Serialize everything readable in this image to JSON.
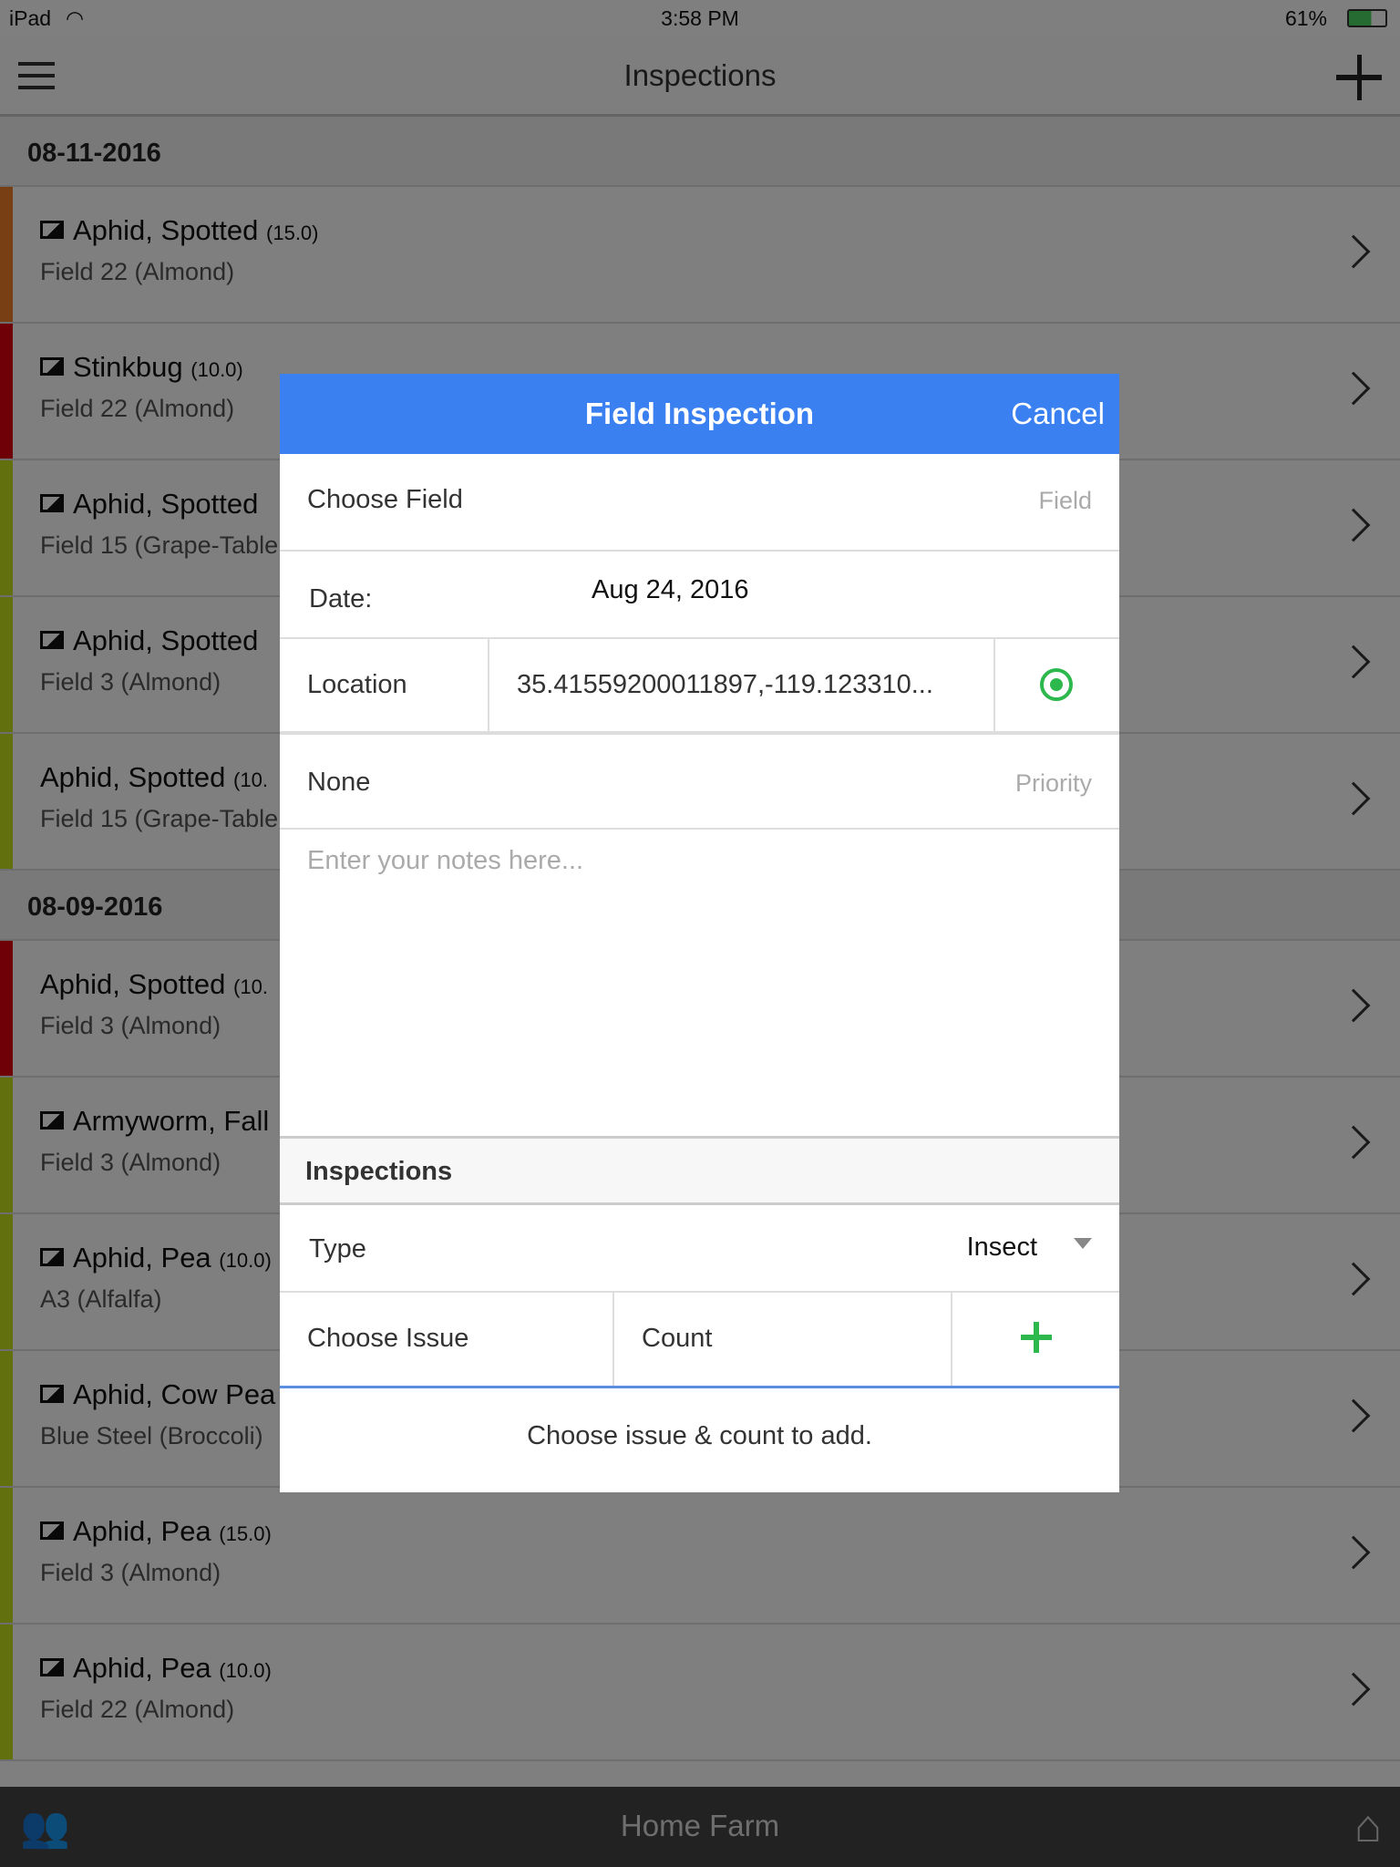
{
  "status_bar": {
    "device": "iPad",
    "time": "3:58 PM",
    "battery": "61%"
  },
  "nav": {
    "title": "Inspections"
  },
  "groups": [
    {
      "date": "08-11-2016",
      "rows": [
        {
          "title": "Aphid, Spotted",
          "count": "(15.0)",
          "subtitle": "Field 22 (Almond)",
          "photo": true,
          "color": "#f07f2a"
        },
        {
          "title": "Stinkbug",
          "count": "(10.0)",
          "subtitle": "Field 22 (Almond)",
          "photo": true,
          "color": "#e00010"
        },
        {
          "title": "Aphid, Spotted",
          "count": "",
          "subtitle": "Field 15 (Grape-Table",
          "photo": true,
          "color": "#c4e21c"
        },
        {
          "title": "Aphid, Spotted",
          "count": "",
          "subtitle": "Field 3 (Almond)",
          "photo": true,
          "color": "#c4e21c"
        },
        {
          "title": "Aphid, Spotted",
          "count": "(10.",
          "subtitle": "Field 15 (Grape-Table",
          "photo": false,
          "color": "#c4e21c"
        }
      ]
    },
    {
      "date": "08-09-2016",
      "rows": [
        {
          "title": "Aphid, Spotted",
          "count": "(10.",
          "subtitle": "Field 3 (Almond)",
          "photo": false,
          "color": "#e00010"
        },
        {
          "title": "Armyworm, Fall",
          "count": "",
          "subtitle": "Field 3 (Almond)",
          "photo": true,
          "color": "#c4e21c"
        },
        {
          "title": "Aphid, Pea",
          "count": "(10.0)",
          "subtitle": "A3 (Alfalfa)",
          "photo": true,
          "color": "#c4e21c"
        },
        {
          "title": "Aphid, Cow Pea",
          "count": "",
          "subtitle": "Blue Steel (Broccoli)",
          "photo": true,
          "color": "#c4e21c"
        },
        {
          "title": "Aphid, Pea",
          "count": "(15.0)",
          "subtitle": "Field 3 (Almond)",
          "photo": true,
          "color": "#c4e21c"
        },
        {
          "title": "Aphid, Pea",
          "count": "(10.0)",
          "subtitle": "Field 22 (Almond)",
          "photo": true,
          "color": "#c4e21c"
        }
      ]
    }
  ],
  "bottom_bar": {
    "title": "Home Farm"
  },
  "modal": {
    "title": "Field Inspection",
    "cancel": "Cancel",
    "field_label": "Choose Field",
    "field_placeholder": "Field",
    "date_label": "Date:",
    "date_value": "Aug 24, 2016",
    "location_label": "Location",
    "location_value": "35.41559200011897,-119.123310...",
    "priority_value": "None",
    "priority_placeholder": "Priority",
    "notes_placeholder": "Enter your notes here...",
    "section": "Inspections",
    "type_label": "Type",
    "type_value": "Insect",
    "issue_placeholder": "Choose Issue",
    "count_placeholder": "Count",
    "empty_message": "Choose issue & count to add.",
    "accent": "#3b80f0",
    "green": "#2db84d"
  }
}
